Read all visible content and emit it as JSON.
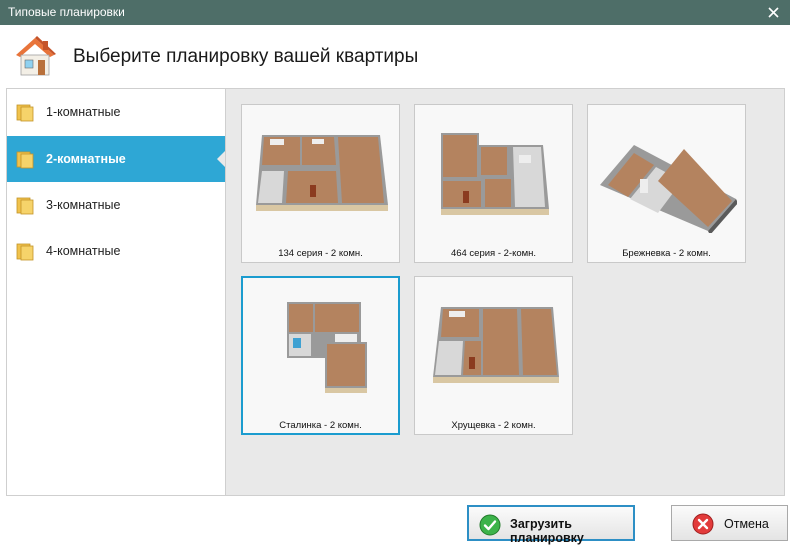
{
  "window": {
    "title": "Типовые планировки"
  },
  "header": {
    "heading": "Выберите планировку вашей квартиры"
  },
  "sidebar": {
    "items": [
      {
        "label": "1-комнатные"
      },
      {
        "label": "2-комнатные",
        "active": true
      },
      {
        "label": "3-комнатные"
      },
      {
        "label": "4-комнатные"
      }
    ]
  },
  "layouts": [
    {
      "caption": "134 серия - 2 комн."
    },
    {
      "caption": "464 серия - 2-комн."
    },
    {
      "caption": "Брежневка - 2 комн."
    },
    {
      "caption": "Сталинка - 2 комн.",
      "selected": true
    },
    {
      "caption": "Хрущевка - 2 комн."
    }
  ],
  "buttons": {
    "load_label": "Загрузить планировку",
    "cancel_label": "Отмена"
  },
  "colors": {
    "titlebar": "#4e6e68",
    "accent": "#2ea7d5",
    "selection_border": "#1b9ccf",
    "floor": "#b4835f",
    "wall": "#d9c7a3"
  }
}
